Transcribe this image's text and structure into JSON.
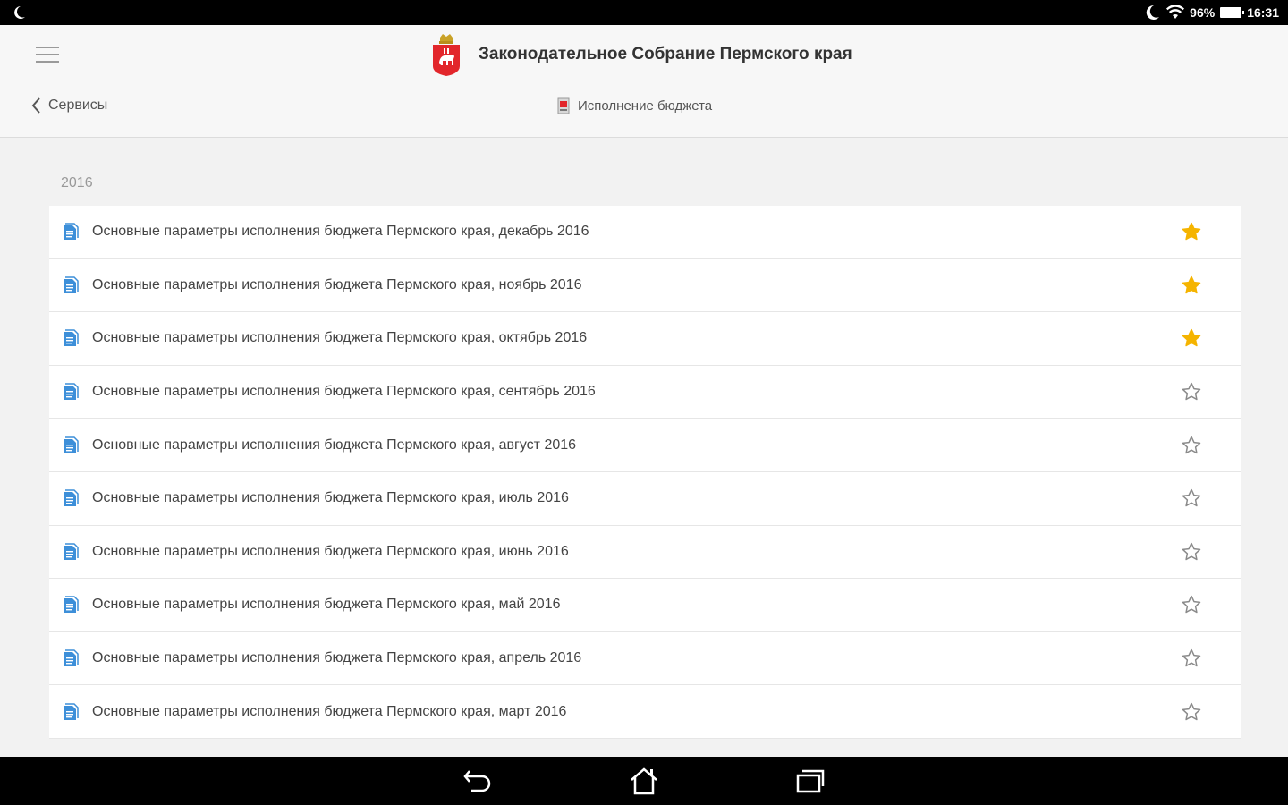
{
  "status": {
    "battery": "96%",
    "time": "16:31"
  },
  "header": {
    "org_title": "Законодательное Собрание Пермского края",
    "back_label": "Сервисы",
    "crumb_label": "Исполнение бюджета"
  },
  "section": {
    "year": "2016"
  },
  "items": [
    {
      "label": "Основные параметры исполнения бюджета Пермского края, декабрь 2016",
      "starred": true
    },
    {
      "label": "Основные параметры исполнения бюджета Пермского края, ноябрь 2016",
      "starred": true
    },
    {
      "label": "Основные параметры исполнения бюджета Пермского края, октябрь 2016",
      "starred": true
    },
    {
      "label": "Основные параметры исполнения бюджета Пермского края, сентябрь 2016",
      "starred": false
    },
    {
      "label": "Основные параметры исполнения бюджета Пермского края, август 2016",
      "starred": false
    },
    {
      "label": "Основные параметры исполнения бюджета Пермского края, июль 2016",
      "starred": false
    },
    {
      "label": "Основные параметры исполнения бюджета Пермского края, июнь 2016",
      "starred": false
    },
    {
      "label": "Основные параметры исполнения бюджета Пермского края, май 2016",
      "starred": false
    },
    {
      "label": "Основные параметры исполнения бюджета Пермского края, апрель 2016",
      "starred": false
    },
    {
      "label": "Основные параметры исполнения бюджета Пермского края, март 2016",
      "starred": false
    }
  ],
  "colors": {
    "star_active": "#f5b400",
    "star_inactive": "#8a8a8a",
    "doc_icon": "#3d8fd9",
    "emblem_red": "#e2262b"
  },
  "icons": {
    "menu": "hamburger-icon",
    "back": "chevron-left-icon",
    "doc": "document-icon",
    "star": "star-icon",
    "emblem": "perm-coat-of-arms-icon"
  }
}
